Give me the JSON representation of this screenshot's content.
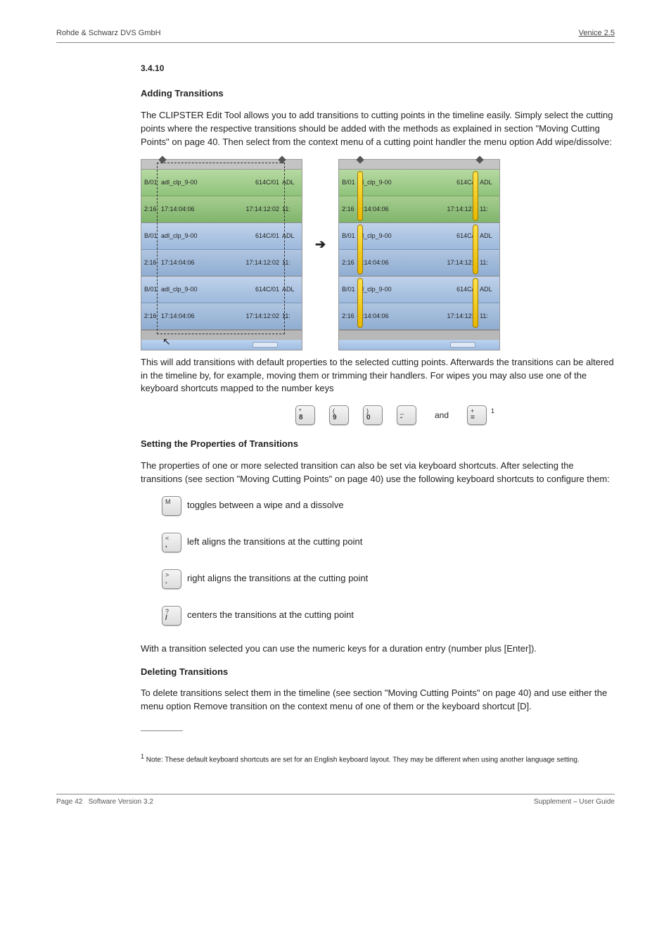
{
  "header": {
    "left": "Rohde & Schwarz DVS GmbH",
    "right": "Venice 2.5"
  },
  "page_number": "Page 42",
  "section": {
    "number": "3.4.10",
    "title": "Adding Transitions"
  },
  "intro_para": "The CLIPSTER Edit Tool allows you to add transitions to cutting points in the timeline easily. Simply select the cutting points where the respective transitions should be added with the methods as explained in section \"Moving Cutting Points\" on page 40. Then select from the context menu of a cutting point handler the menu option Add wipe/dissolve:",
  "explain_para": "This will add transitions with default properties to the selected cutting points. Afterwards the transitions can be altered in the timeline by, for example, moving them or trimming their handlers. For wipes you may also use one of the keyboard shortcuts mapped to the number keys",
  "key_row": {
    "k1_top": "*",
    "k1_bot": "8",
    "k2_top": "(",
    "k2_bot": "9",
    "k3_top": ")",
    "k3_bot": "0",
    "k4_top": "_",
    "k4_bot": "-",
    "and": "and",
    "k5_top": "+",
    "k5_bot": "="
  },
  "prop_title": "Setting the Properties of Transitions",
  "prop_para": "The properties of one or more selected transition can also be set via keyboard shortcuts. After selecting the transitions (see section \"Moving Cutting Points\" on page 40) use the following keyboard shortcuts to configure them:",
  "bullets": [
    {
      "key_top": "M",
      "key_bot": "",
      "text": "toggles between a wipe and a dissolve"
    },
    {
      "key_top": "<",
      "key_bot": ",",
      "text": "left aligns the transitions at the cutting point"
    },
    {
      "key_top": ">",
      "key_bot": ".",
      "text": "right aligns the transitions at the cutting point"
    },
    {
      "key_top": "?",
      "key_bot": "/",
      "text": "centers the transitions at the cutting point"
    }
  ],
  "after_bullets": "With a transition selected you can use the numeric keys for a duration entry (number plus [Enter]).",
  "footnote": {
    "num": "1",
    "text": "Note: These default keyboard shortcuts are set for an English keyboard layout. They may be different when using another language setting."
  },
  "delete_title": "Deleting Transitions",
  "delete_para": "To delete transitions select them in the timeline (see section \"Moving Cutting Points\" on page 40) and use either the menu option Remove transition on the context menu of one of them or the keyboard shortcut [D].",
  "footer": {
    "left": "Software Version 3.2",
    "right": "Supplement – User Guide"
  },
  "timeline": {
    "left_edge": "B/01",
    "name": "adl_clp_9-00",
    "code": "614C/01",
    "right_edge": "ADL",
    "left_edge_t": "2:16",
    "t1": "17:14:04:06",
    "t2": "17:14:12:02",
    "right_edge_t": "11:",
    "r_left_edge": "B/01",
    "r_name": "dl_clp_9-00",
    "r_code": "614C/0",
    "r_right_edge": "ADL",
    "r_left_edge_t": "2:16",
    "r_t1": "7:14:04:06",
    "r_t2": "17:14:12:0",
    "r_right_edge_t": "11:"
  }
}
